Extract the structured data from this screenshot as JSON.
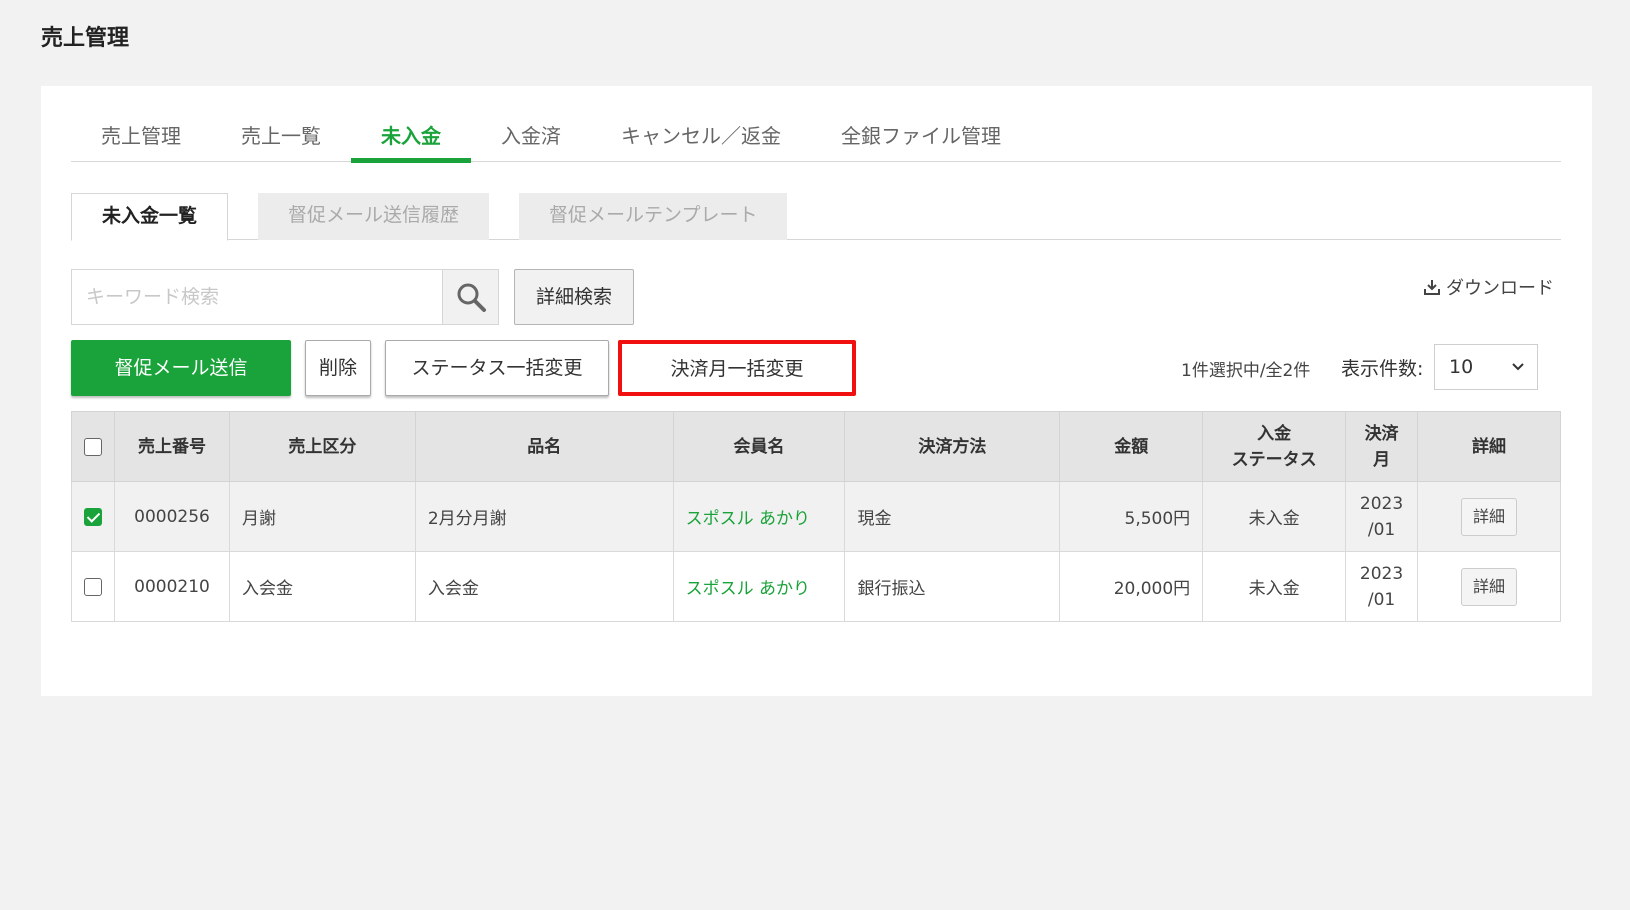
{
  "page_title": "売上管理",
  "main_tabs": [
    "売上管理",
    "売上一覧",
    "未入金",
    "入金済",
    "キャンセル／返金",
    "全銀ファイル管理"
  ],
  "sub_tabs": [
    "未入金一覧",
    "督促メール送信履歴",
    "督促メールテンプレート"
  ],
  "search": {
    "placeholder": "キーワード検索",
    "advanced_label": "詳細検索"
  },
  "download_label": "ダウンロード",
  "actions": {
    "send_reminder": "督促メール送信",
    "delete": "削除",
    "bulk_status": "ステータス一括変更",
    "bulk_month": "決済月一括変更"
  },
  "selection_count": "1件選択中/全2件",
  "per_page": {
    "label": "表示件数:",
    "value": "10"
  },
  "table": {
    "headers": {
      "number": "売上番号",
      "category": "売上区分",
      "item": "品名",
      "member": "会員名",
      "method": "決済方法",
      "amount": "金額",
      "status_1": "入金",
      "status_2": "ステータス",
      "month_1": "決済",
      "month_2": "月",
      "detail": "詳細"
    },
    "rows": [
      {
        "checked": true,
        "number": "0000256",
        "category": "月謝",
        "item": "2月分月謝",
        "member": "スポスル あかり",
        "method": "現金",
        "amount": "5,500円",
        "status": "未入金",
        "month_1": "2023",
        "month_2": "/01",
        "detail": "詳細"
      },
      {
        "checked": false,
        "number": "0000210",
        "category": "入会金",
        "item": "入会金",
        "member": "スポスル あかり",
        "method": "銀行振込",
        "amount": "20,000円",
        "status": "未入金",
        "month_1": "2023",
        "month_2": "/01",
        "detail": "詳細"
      }
    ]
  },
  "colors": {
    "accent": "#1aa33a",
    "highlight": "#f01010"
  }
}
